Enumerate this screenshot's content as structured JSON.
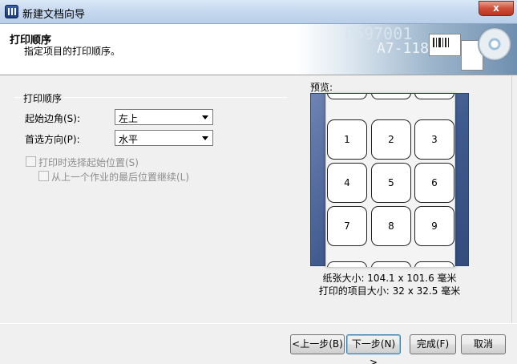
{
  "window": {
    "title": "新建文档向导",
    "close_label": "x"
  },
  "header": {
    "title": "打印顺序",
    "subtitle": "指定项目的打印顺序。",
    "banner_text_1": "0597001",
    "banner_text_2": "A7-118"
  },
  "order_group": {
    "legend": "打印顺序",
    "start_corner": {
      "label": "起始边角(S):",
      "value": "左上"
    },
    "direction": {
      "label": "首选方向(P):",
      "value": "水平"
    },
    "choose_start_at_print": {
      "label": "打印时选择起始位置(S)",
      "checked": false,
      "enabled": false
    },
    "continue_from_last": {
      "label": "从上一个作业的最后位置继续(L)",
      "checked": false,
      "enabled": false
    }
  },
  "preview": {
    "label": "预览:",
    "cells": [
      "1",
      "2",
      "3",
      "4",
      "5",
      "6",
      "7",
      "8",
      "9"
    ],
    "paper_size": "纸张大小: 104.1 x 101.6 毫米",
    "item_size": "打印的项目大小: 32 x 32.5 毫米"
  },
  "buttons": {
    "back": "<上一步(B)",
    "next": "下一步(N) >",
    "finish": "完成(F)",
    "cancel": "取消"
  }
}
